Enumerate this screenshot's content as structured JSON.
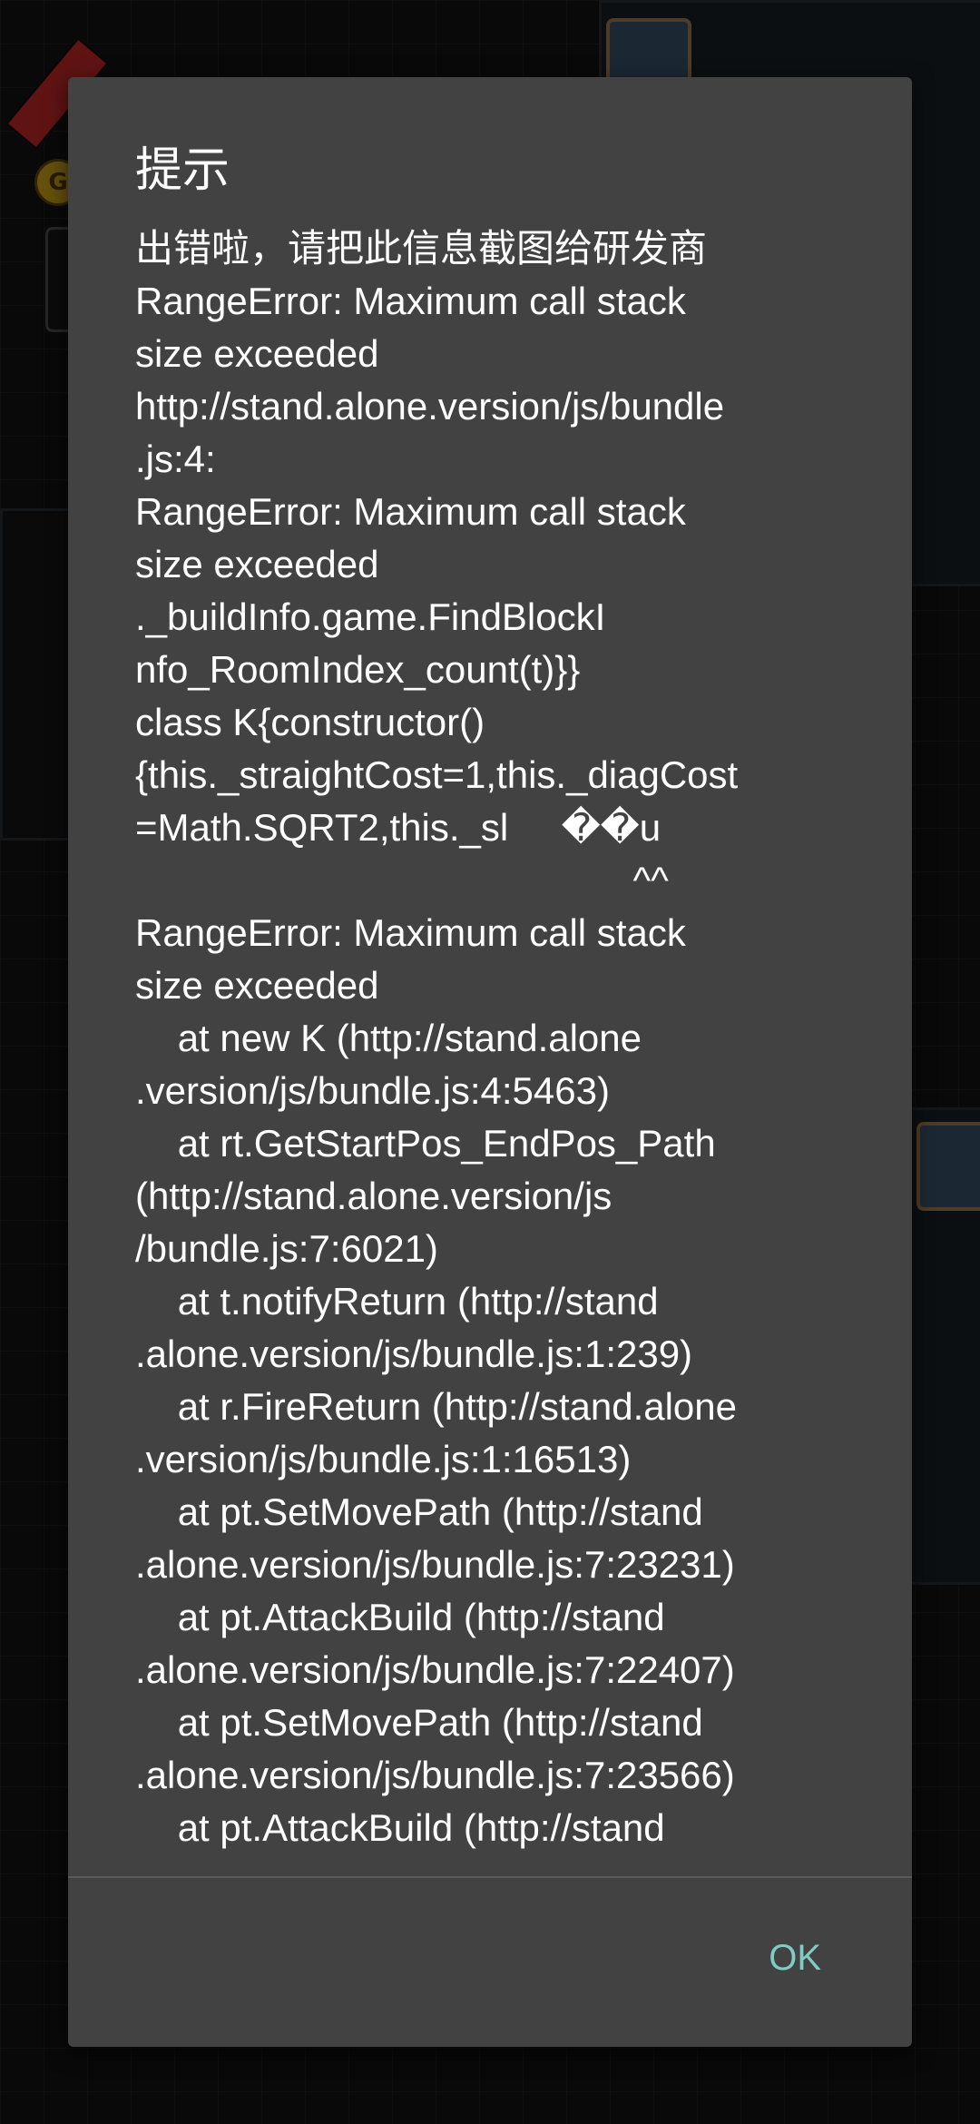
{
  "dialog": {
    "title": "提示",
    "body_lines": [
      "出错啦，请把此信息截图给研发商",
      "RangeError: Maximum call stack",
      "size exceeded",
      "http://stand.alone.version/js/bundle",
      ".js:4:",
      "RangeError: Maximum call stack",
      "size exceeded",
      "._buildInfo.game.FindBlockI",
      "nfo_RoomIndex_count(t)}}",
      "class K{constructor()",
      "{this._straightCost=1,this._diagCost",
      "=Math.SQRT2,this._sl     ��u",
      "                                               ^^",
      "RangeError: Maximum call stack",
      "size exceeded",
      "    at new K (http://stand.alone",
      ".version/js/bundle.js:4:5463)",
      "    at rt.GetStartPos_EndPos_Path",
      "(http://stand.alone.version/js",
      "/bundle.js:7:6021)",
      "    at t.notifyReturn (http://stand",
      ".alone.version/js/bundle.js:1:239)",
      "    at r.FireReturn (http://stand.alone",
      ".version/js/bundle.js:1:16513)",
      "    at pt.SetMovePath (http://stand",
      ".alone.version/js/bundle.js:7:23231)",
      "    at pt.AttackBuild (http://stand",
      ".alone.version/js/bundle.js:7:22407)",
      "    at pt.SetMovePath (http://stand",
      ".alone.version/js/bundle.js:7:23566)",
      "    at pt.AttackBuild (http://stand"
    ],
    "ok_label": "OK"
  },
  "background": {
    "coin_letter": "G"
  },
  "colors": {
    "dialog_bg": "#424242",
    "accent": "#80cbc4",
    "text": "#ffffff"
  }
}
